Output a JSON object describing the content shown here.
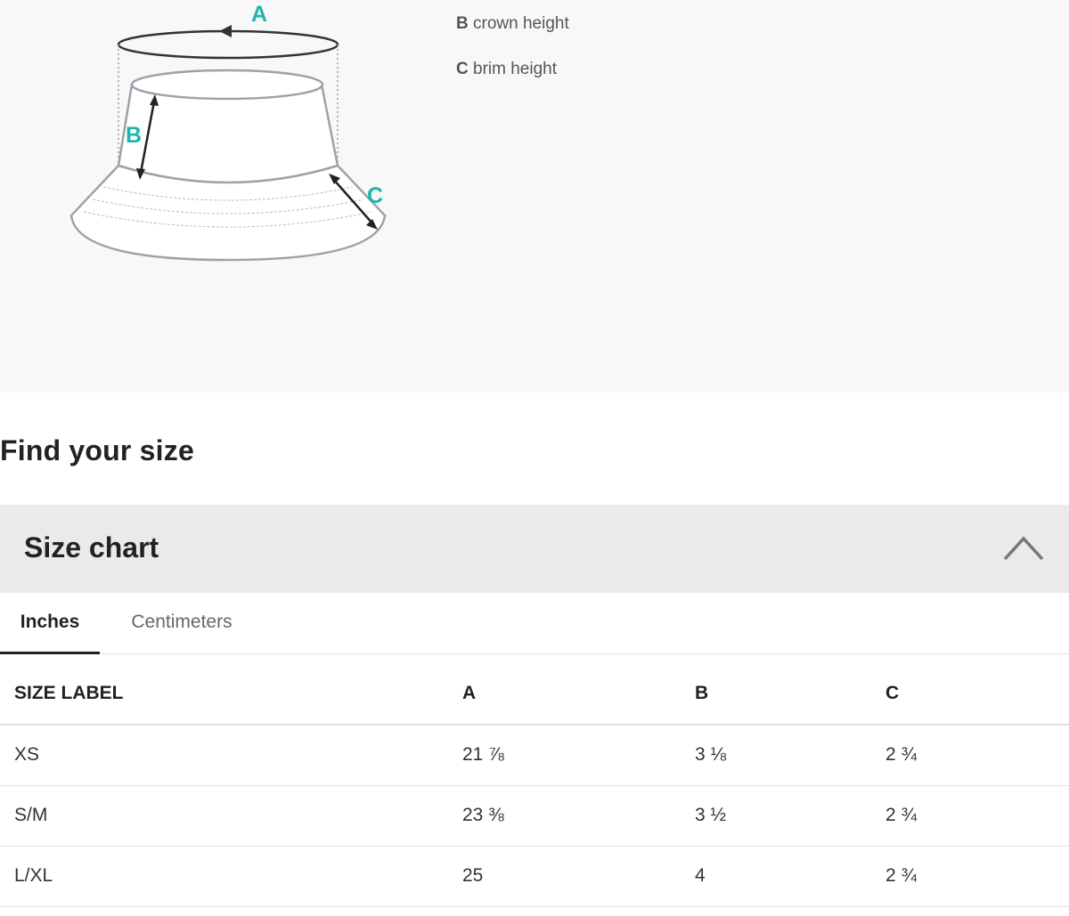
{
  "diagram": {
    "labels": {
      "a": "A",
      "b": "B",
      "c": "C"
    },
    "accent_color": "#1fb5ad"
  },
  "legend": [
    {
      "key": "B",
      "text": "crown height"
    },
    {
      "key": "C",
      "text": "brim height"
    }
  ],
  "page_heading": "Find your size",
  "size_chart": {
    "title": "Size chart",
    "expanded": true,
    "tabs": [
      {
        "label": "Inches",
        "active": true
      },
      {
        "label": "Centimeters",
        "active": false
      }
    ],
    "columns": [
      "SIZE LABEL",
      "A",
      "B",
      "C"
    ],
    "rows": [
      [
        "XS",
        "21 ⅞",
        "3 ⅛",
        "2 ¾"
      ],
      [
        "S/M",
        "23 ⅜",
        "3 ½",
        "2 ¾"
      ],
      [
        "L/XL",
        "25",
        "4",
        "2 ¾"
      ]
    ]
  }
}
